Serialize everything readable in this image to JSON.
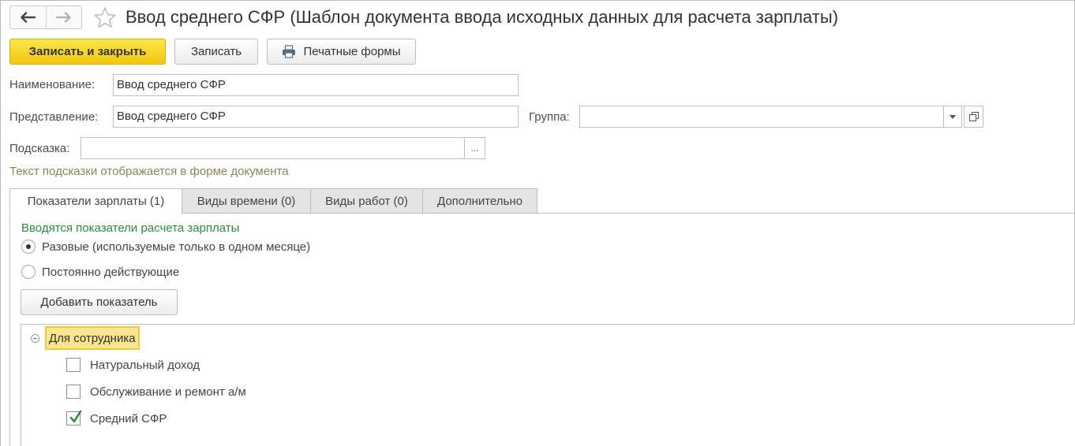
{
  "window": {
    "title": "Ввод среднего СФР (Шаблон документа ввода исходных данных для расчета зарплаты)"
  },
  "toolbar": {
    "save_close": "Записать и закрыть",
    "save": "Записать",
    "print_forms": "Печатные формы"
  },
  "form": {
    "name_label": "Наименование:",
    "name_value": "Ввод среднего СФР",
    "presentation_label": "Представление:",
    "presentation_value": "Ввод среднего СФР",
    "group_label": "Группа:",
    "group_value": "",
    "hint_label": "Подсказка:",
    "hint_value": "",
    "hint_dots": "...",
    "hint_note": "Текст подсказки отображается в форме документа"
  },
  "tabs": [
    {
      "label": "Показатели зарплаты (1)",
      "active": true
    },
    {
      "label": "Виды времени (0)",
      "active": false
    },
    {
      "label": "Виды работ (0)",
      "active": false
    },
    {
      "label": "Дополнительно",
      "active": false
    }
  ],
  "indicators": {
    "section_title": "Вводятся показатели расчета зарплаты",
    "radio_once": "Разовые (используемые только в одном месяце)",
    "radio_permanent": "Постоянно действующие",
    "selected": "once",
    "add_button": "Добавить показатель"
  },
  "tree": {
    "group": "Для сотрудника",
    "items": [
      {
        "label": "Натуральный доход",
        "checked": false
      },
      {
        "label": "Обслуживание и ремонт а/м",
        "checked": false
      },
      {
        "label": "Средний СФР",
        "checked": true
      }
    ]
  },
  "icons": {
    "back": "arrow-left-icon",
    "forward": "arrow-right-icon",
    "favorite": "star-icon",
    "print": "printer-icon",
    "dropdown": "chevron-down-icon",
    "open": "open-window-icon"
  },
  "colors": {
    "primary_button": "#f2c811",
    "section_title": "#2e8b3e",
    "hint_text": "#8e8458",
    "tree_selection": "#fbe58e"
  }
}
